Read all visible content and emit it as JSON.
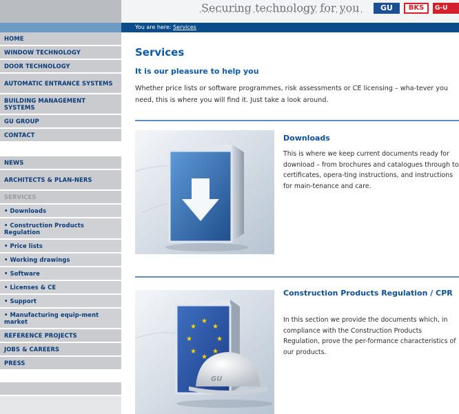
{
  "header": {
    "tagline": "Securing technology for you",
    "logos": [
      "GU",
      "BKS",
      "G-U"
    ]
  },
  "breadcrumb": {
    "prefix": "You are here:",
    "current": "Services"
  },
  "sidebar": {
    "items": [
      {
        "label": "HOME"
      },
      {
        "label": "WINDOW TECHNOLOGY"
      },
      {
        "label": "DOOR TECHNOLOGY"
      },
      {
        "label": "AUTOMATIC ENTRANCE SYSTEMS"
      },
      {
        "label": "BUILDING MANAGEMENT SYSTEMS"
      },
      {
        "label": "GU GROUP"
      },
      {
        "label": "CONTACT"
      },
      {
        "label": "NEWS"
      },
      {
        "label": "ARCHITECTS & PLAN-NERS"
      },
      {
        "label": "SERVICES"
      },
      {
        "label": "• Downloads"
      },
      {
        "label": "• Construction Products Regulation"
      },
      {
        "label": "• Price lists"
      },
      {
        "label": "• Working drawings"
      },
      {
        "label": "• Software"
      },
      {
        "label": "• Licenses & CE"
      },
      {
        "label": "• Support"
      },
      {
        "label": "• Manufacturing equip-ment market"
      },
      {
        "label": "REFERENCE PROJECTS"
      },
      {
        "label": "JOBS & CAREERS"
      },
      {
        "label": "PRESS"
      }
    ]
  },
  "main": {
    "title": "Services",
    "subtitle": "It is our pleasure to help you",
    "intro": "Whether price lists or software programmes, risk assessments or CE licensing – wha-tever you need, this is where you will find it. Just take a look around.",
    "sections": [
      {
        "title": "Downloads",
        "text": "This is where we keep current documents ready for download – from brochures and catalogues through to certificates, opera-ting instructions, and instructions for main-tenance and care.",
        "image_icon": "download-arrow-icon"
      },
      {
        "title": "Construction Products Regulation / CPR",
        "text": "In this section we provide the documents which, in compliance with the Construction Products Regulation, prove the per-formance characteristics of our products.",
        "image_icon": "eu-flag-helmet-icon",
        "helmet_label": "GU"
      }
    ]
  },
  "colors": {
    "brand_blue": "#0b4d8c",
    "title_blue": "#0b5aa8",
    "nav_text": "#0b3c7a",
    "nav_bg": "#c9cbce",
    "logo_red": "#d4202b"
  }
}
